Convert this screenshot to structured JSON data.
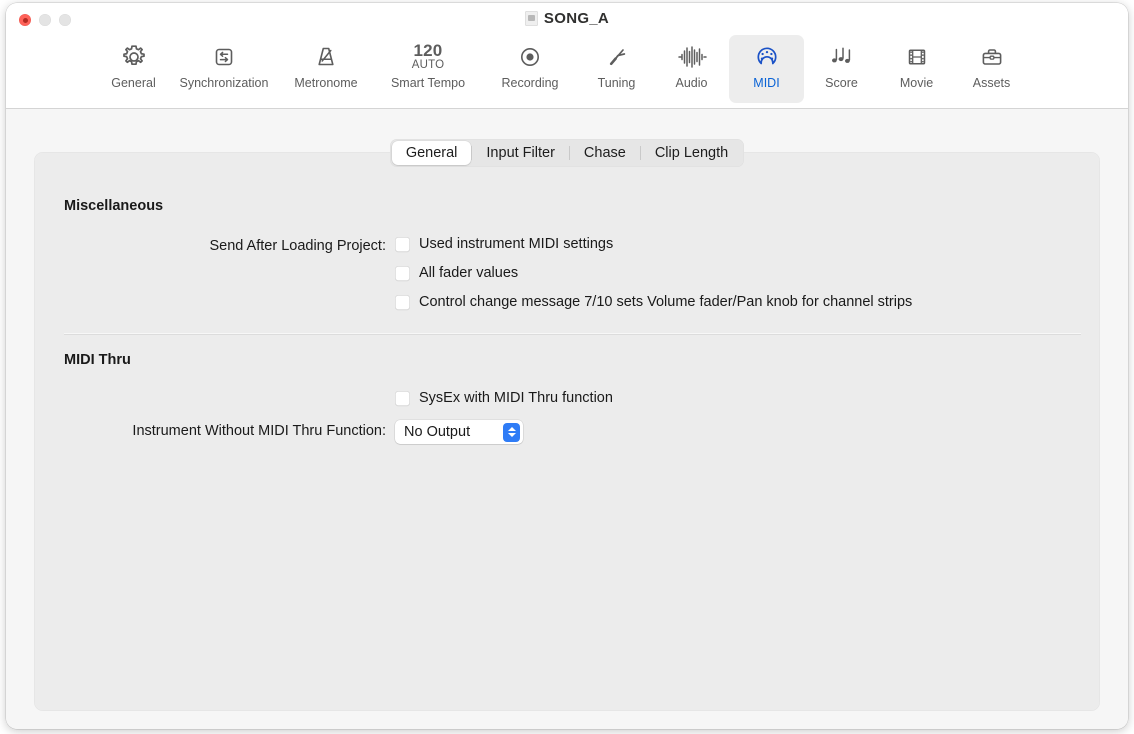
{
  "window": {
    "title": "SONG_A",
    "doc_icon": "document-icon",
    "traffic_lights": [
      "close",
      "minimize",
      "zoom"
    ]
  },
  "toolbar": {
    "items": [
      {
        "label": "General",
        "icon": "gear-icon",
        "selected": false
      },
      {
        "label": "Synchronization",
        "icon": "sync-icon",
        "selected": false
      },
      {
        "label": "Metronome",
        "icon": "metronome-icon",
        "selected": false
      },
      {
        "label": "Smart Tempo",
        "icon": "tempo-icon",
        "selected": false,
        "tempo_value": "120",
        "tempo_mode": "AUTO"
      },
      {
        "label": "Recording",
        "icon": "record-icon",
        "selected": false
      },
      {
        "label": "Tuning",
        "icon": "tuning-fork-icon",
        "selected": false
      },
      {
        "label": "Audio",
        "icon": "waveform-icon",
        "selected": false
      },
      {
        "label": "MIDI",
        "icon": "midi-din-icon",
        "selected": true
      },
      {
        "label": "Score",
        "icon": "music-notes-icon",
        "selected": false
      },
      {
        "label": "Movie",
        "icon": "film-strip-icon",
        "selected": false
      },
      {
        "label": "Assets",
        "icon": "briefcase-icon",
        "selected": false
      }
    ]
  },
  "tabs": {
    "items": [
      {
        "label": "General",
        "active": true
      },
      {
        "label": "Input Filter",
        "active": false
      },
      {
        "label": "Chase",
        "active": false
      },
      {
        "label": "Clip Length",
        "active": false
      }
    ]
  },
  "main": {
    "miscellaneous": {
      "heading": "Miscellaneous",
      "send_after_loading_label": "Send After Loading Project:",
      "checkboxes": [
        {
          "label": "Used instrument MIDI settings",
          "checked": false
        },
        {
          "label": "All fader values",
          "checked": false
        },
        {
          "label": "Control change message 7/10 sets Volume fader/Pan knob for channel strips",
          "checked": false
        }
      ]
    },
    "midi_thru": {
      "heading": "MIDI Thru",
      "sysex_checkbox": {
        "label": "SysEx with MIDI Thru function",
        "checked": false
      },
      "instrument_label": "Instrument Without MIDI Thru Function:",
      "instrument_value": "No Output"
    }
  },
  "colors": {
    "accent": "#0a63d6",
    "popup_arrow_bg": "#2f7cf6",
    "close_button": "#ff6259",
    "panel_bg": "#ececec",
    "toolbar_bg": "#ffffff"
  }
}
